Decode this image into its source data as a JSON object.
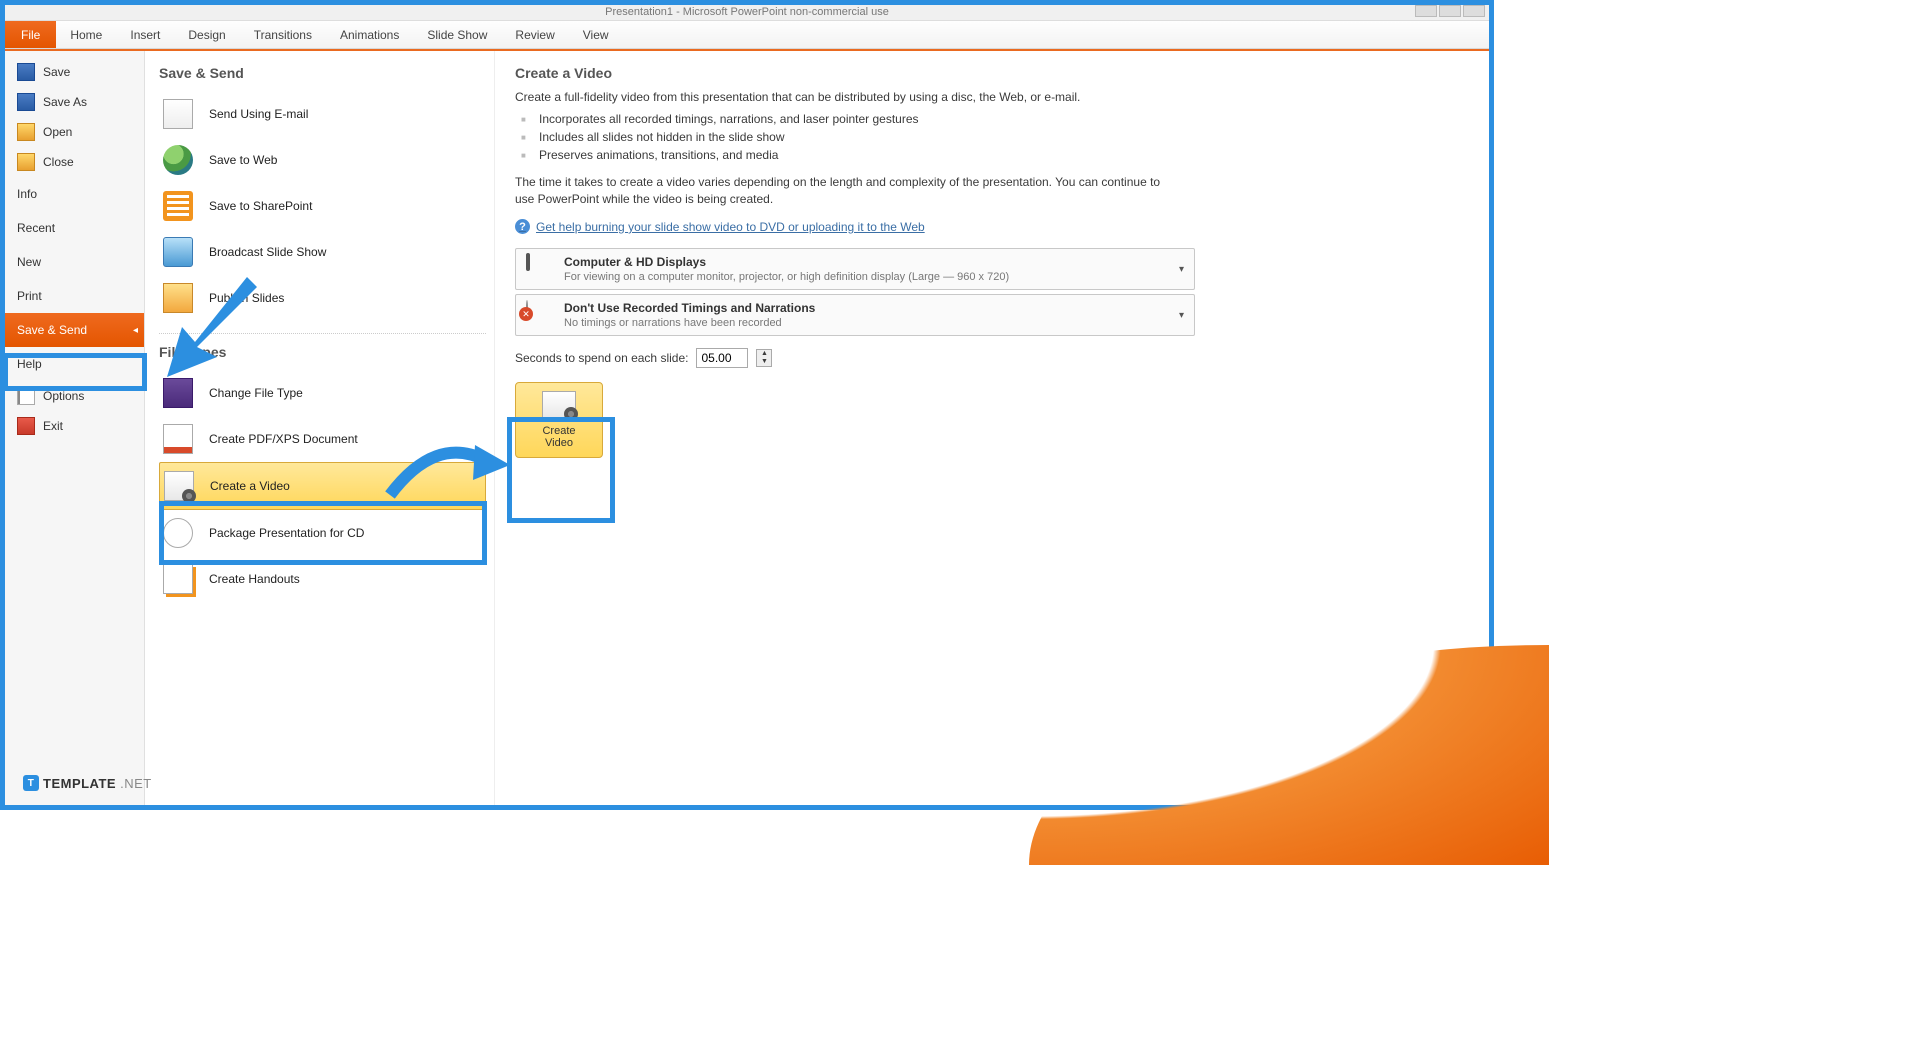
{
  "titlebar": {
    "text": "Presentation1 - Microsoft PowerPoint non-commercial use"
  },
  "ribbon": {
    "tabs": [
      "File",
      "Home",
      "Insert",
      "Design",
      "Transitions",
      "Animations",
      "Slide Show",
      "Review",
      "View"
    ],
    "active": "File"
  },
  "leftnav": {
    "save": "Save",
    "saveas": "Save As",
    "open": "Open",
    "close": "Close",
    "info": "Info",
    "recent": "Recent",
    "new": "New",
    "print": "Print",
    "savesend": "Save & Send",
    "help": "Help",
    "options": "Options",
    "exit": "Exit"
  },
  "midcol": {
    "h_send": "Save & Send",
    "send_email": "Send Using E-mail",
    "save_web": "Save to Web",
    "save_sp": "Save to SharePoint",
    "broadcast": "Broadcast Slide Show",
    "publish": "Publish Slides",
    "h_filetypes": "File Types",
    "change_ft": "Change File Type",
    "pdf": "Create PDF/XPS Document",
    "video": "Create a Video",
    "package": "Package Presentation for CD",
    "handouts": "Create Handouts"
  },
  "main": {
    "title": "Create a Video",
    "intro": "Create a full-fidelity video from this presentation that can be distributed by using a disc, the Web, or e-mail.",
    "b1": "Incorporates all recorded timings, narrations, and laser pointer gestures",
    "b2": "Includes all slides not hidden in the slide show",
    "b3": "Preserves animations, transitions, and media",
    "note": "The time it takes to create a video varies depending on the length and complexity of the presentation. You can continue to use PowerPoint while the video is being created.",
    "helplink": "Get help burning your slide show video to DVD or uploading it to the Web",
    "dd1_title": "Computer & HD Displays",
    "dd1_sub": "For viewing on a computer monitor, projector, or high definition display  (Large — 960 x 720)",
    "dd2_title": "Don't Use Recorded Timings and Narrations",
    "dd2_sub": "No timings or narrations have been recorded",
    "seconds_label": "Seconds to spend on each slide:",
    "seconds_value": "05.00",
    "create_btn": "Create\nVideo",
    "create_btn_l1": "Create",
    "create_btn_l2": "Video"
  },
  "watermark": {
    "brand": "TEMPLATE",
    "suffix": ".NET"
  }
}
